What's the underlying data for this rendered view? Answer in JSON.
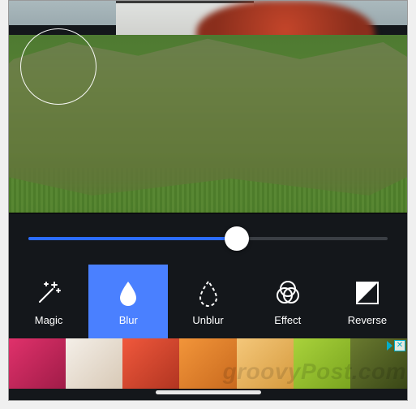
{
  "slider": {
    "value": 58
  },
  "tools": [
    {
      "id": "magic",
      "label": "Magic",
      "active": false
    },
    {
      "id": "blur",
      "label": "Blur",
      "active": true
    },
    {
      "id": "unblur",
      "label": "Unblur",
      "active": false
    },
    {
      "id": "effect",
      "label": "Effect",
      "active": false
    },
    {
      "id": "reverse",
      "label": "Reverse",
      "active": false
    }
  ],
  "ad": {
    "close_glyph": "✕"
  },
  "watermark": "groovyPost.com"
}
